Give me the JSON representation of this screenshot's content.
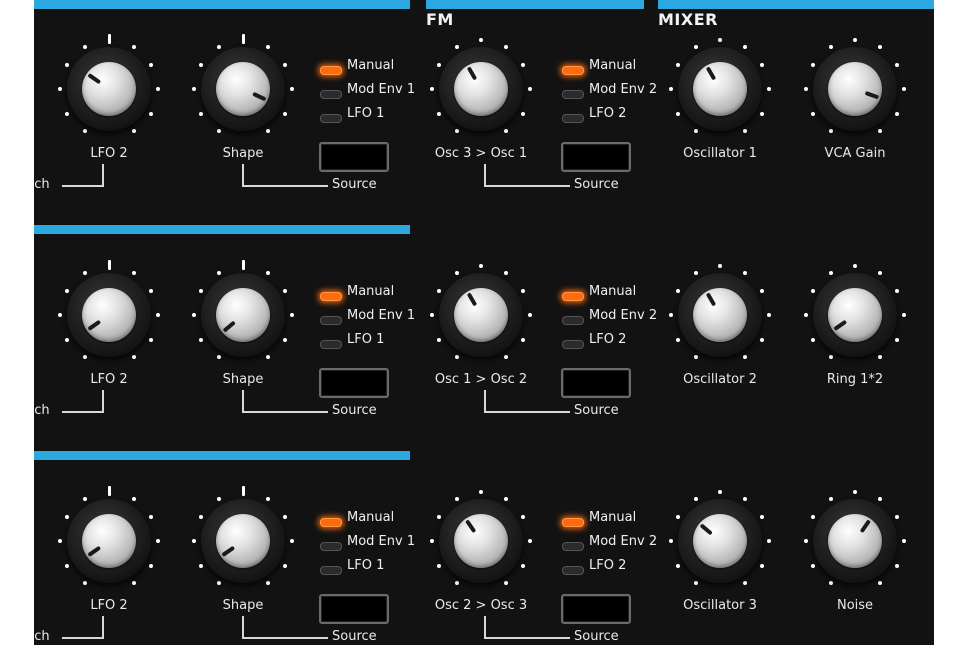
{
  "sections": {
    "fm_title": "FM",
    "mixer_title": "MIXER"
  },
  "rows": [
    {
      "lfo_knob_label": "LFO 2",
      "pitch_label": "Pitch",
      "shape_knob_label": "Shape",
      "source_left_label": "Source",
      "left_leds": [
        "Manual",
        "Mod Env 1",
        "LFO 1"
      ],
      "fm_knob_label": "Osc 3 > Osc 1",
      "source_right_label": "Source",
      "right_leds": [
        "Manual",
        "Mod Env 2",
        "LFO 2"
      ],
      "mix_knob1_label": "Oscillator 1",
      "mix_knob2_label": "VCA Gain"
    },
    {
      "lfo_knob_label": "LFO 2",
      "pitch_label": "Pitch",
      "shape_knob_label": "Shape",
      "source_left_label": "Source",
      "left_leds": [
        "Manual",
        "Mod Env 1",
        "LFO 1"
      ],
      "fm_knob_label": "Osc 1 > Osc 2",
      "source_right_label": "Source",
      "right_leds": [
        "Manual",
        "Mod Env 2",
        "LFO 2"
      ],
      "mix_knob1_label": "Oscillator 2",
      "mix_knob2_label": "Ring 1*2"
    },
    {
      "lfo_knob_label": "LFO 2",
      "pitch_label": "Pitch",
      "shape_knob_label": "Shape",
      "source_left_label": "Source",
      "left_leds": [
        "Manual",
        "Mod Env 1",
        "LFO 1"
      ],
      "fm_knob_label": "Osc 2 > Osc 3",
      "source_right_label": "Source",
      "right_leds": [
        "Manual",
        "Mod Env 2",
        "LFO 2"
      ],
      "mix_knob1_label": "Oscillator 3",
      "mix_knob2_label": "Noise"
    }
  ],
  "active_led": "Manual",
  "knob_angles_deg": [
    [
      -55,
      115,
      -30,
      -30,
      110
    ],
    [
      -125,
      -130,
      -30,
      -30,
      -125
    ],
    [
      -125,
      -125,
      -35,
      -50,
      35
    ]
  ],
  "colors": {
    "accent_bar": "#2aa8df",
    "led_on": "#ff6a10",
    "panel": "#121212"
  }
}
